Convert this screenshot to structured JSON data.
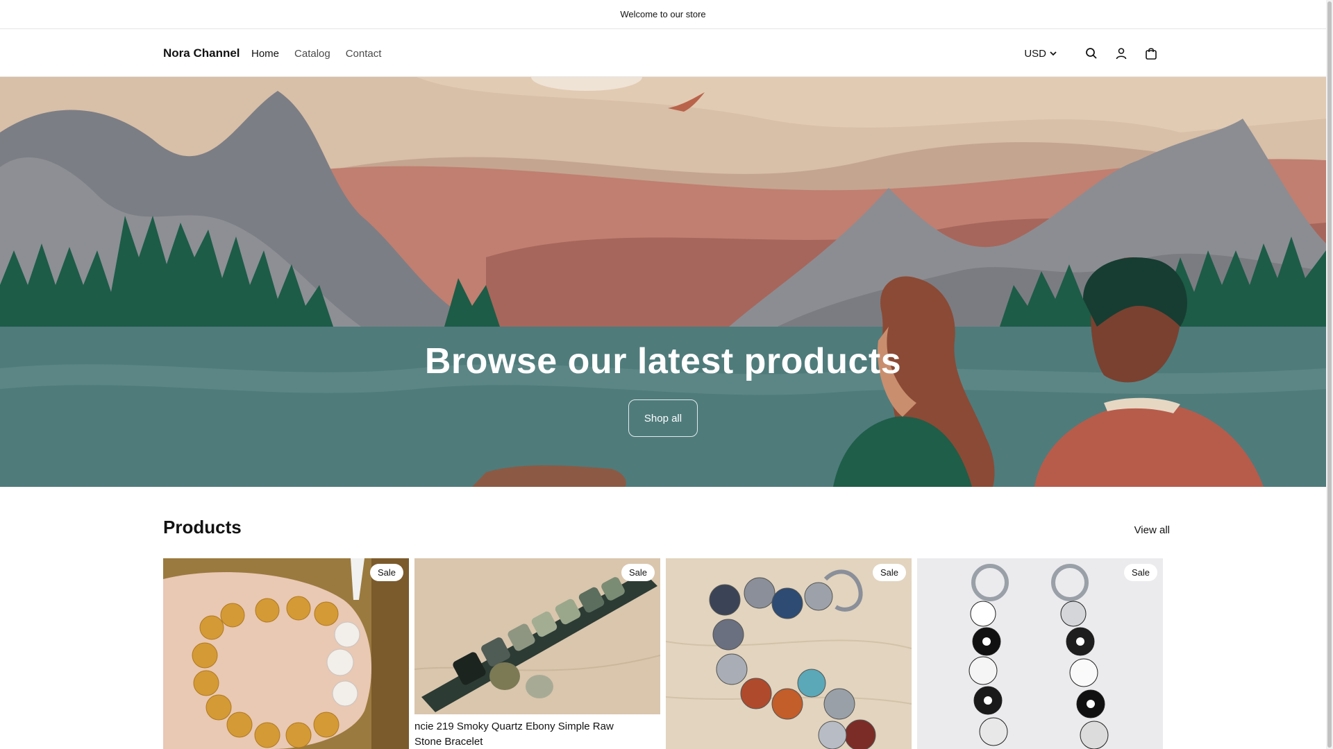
{
  "announcement": {
    "text": "Welcome to our store"
  },
  "header": {
    "brand": "Nora Channel",
    "nav": [
      {
        "label": "Home",
        "active": true
      },
      {
        "label": "Catalog",
        "active": false
      },
      {
        "label": "Contact",
        "active": false
      }
    ],
    "currency": "USD",
    "icons": [
      "search-icon",
      "account-icon",
      "cart-icon"
    ]
  },
  "hero": {
    "title": "Browse our latest products",
    "button_label": "Shop all",
    "colors": {
      "water": "#4d7a7a",
      "sky": "#c8a992",
      "mountain": "#7d7f85",
      "forest": "#1e5c47"
    }
  },
  "products": {
    "heading": "Products",
    "view_all": "View all",
    "items": [
      {
        "badge": "Sale",
        "title": ""
      },
      {
        "badge": "Sale",
        "title": "ncie 219 Smoky Quartz Ebony Simple Raw Stone Bracelet"
      },
      {
        "badge": "Sale",
        "title": ""
      },
      {
        "badge": "Sale",
        "title": ""
      }
    ]
  }
}
